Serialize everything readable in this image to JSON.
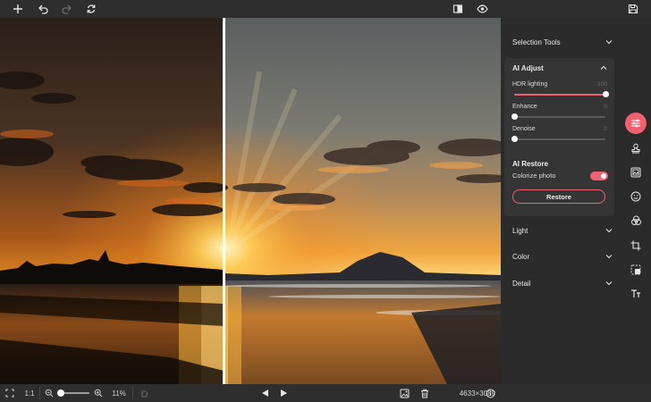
{
  "toolbar": {
    "left_icons": [
      "plus-icon",
      "undo-icon",
      "redo-icon",
      "sync-icon"
    ],
    "right_icons": [
      "compare-icon",
      "eye-icon",
      "save-icon"
    ]
  },
  "canvas": {
    "split_position_percent": 44.6,
    "image_description_icon": "photo-preview"
  },
  "bottom": {
    "fit_icon": "fullscreen-icon",
    "ratio_label": "1:1",
    "zoom_out_icon": "zoom-out-icon",
    "zoom_in_icon": "zoom-in-icon",
    "zoom_percent": "11%",
    "hand_icon": "hand-icon",
    "prev_icon": "prev-arrow-icon",
    "next_icon": "next-arrow-icon",
    "image_icon": "image-icon",
    "delete_icon": "trash-icon",
    "dimensions": "4633×3089",
    "info_icon": "info-icon"
  },
  "panel": {
    "selection_tools": "Selection Tools",
    "ai_adjust": {
      "title": "AI Adjust",
      "sliders": [
        {
          "label": "HDR lighting",
          "value": "100",
          "fraction": 1.0
        },
        {
          "label": "Enhance",
          "value": "0",
          "fraction": 0.0
        },
        {
          "label": "Denoise",
          "value": "0",
          "fraction": 0.0
        }
      ],
      "restore_title": "AI Restore",
      "colorize_label": "Colorize photo",
      "colorize_on": true,
      "restore_button": "Restore"
    },
    "light": "Light",
    "color": "Color",
    "detail": "Detail"
  },
  "rail": {
    "icons": [
      "adjust-sliders-icon",
      "stamp-icon",
      "frame-image-icon",
      "smile-icon",
      "blend-circles-icon",
      "crop-icon",
      "layers-icon",
      "text-icon"
    ],
    "active_index": 0
  },
  "colors": {
    "accent": "#f0606e",
    "background": "#2b2b2b",
    "card": "#353535"
  }
}
